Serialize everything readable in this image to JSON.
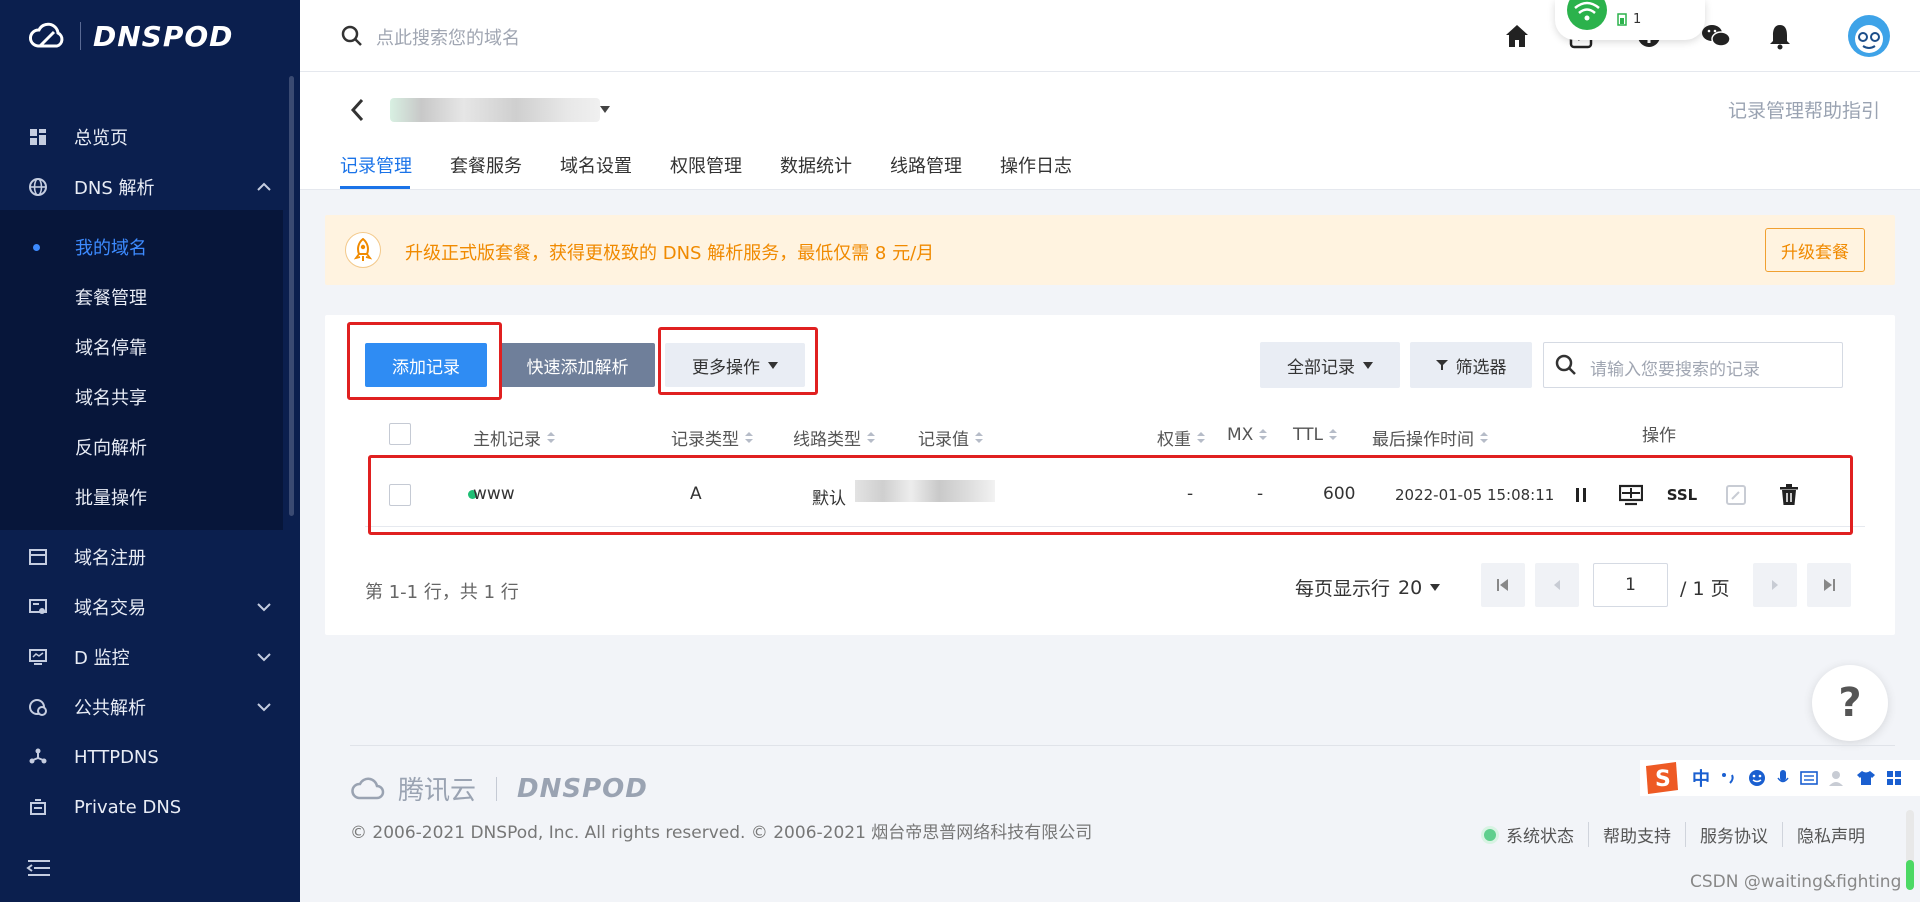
{
  "sidebar": {
    "brand": "DNSPOD",
    "items": [
      {
        "label": "总览页",
        "icon": "dashboard-icon"
      },
      {
        "label": "DNS 解析",
        "icon": "globe-icon"
      },
      {
        "label": "域名注册",
        "icon": "register-icon"
      },
      {
        "label": "域名交易",
        "icon": "trade-icon"
      },
      {
        "label": "D 监控",
        "icon": "monitor-icon"
      },
      {
        "label": "公共解析",
        "icon": "public-dns-icon"
      },
      {
        "label": "HTTPDNS",
        "icon": "httpdns-icon"
      },
      {
        "label": "Private DNS",
        "icon": "private-dns-icon"
      }
    ],
    "subitems": [
      {
        "label": "我的域名"
      },
      {
        "label": "套餐管理"
      },
      {
        "label": "域名停靠"
      },
      {
        "label": "域名共享"
      },
      {
        "label": "反向解析"
      },
      {
        "label": "批量操作"
      }
    ]
  },
  "header": {
    "search_placeholder": "点此搜索您的域名",
    "wifi_badge": "1"
  },
  "subheader": {
    "help_link": "记录管理帮助指引",
    "tabs": [
      {
        "label": "记录管理"
      },
      {
        "label": "套餐服务"
      },
      {
        "label": "域名设置"
      },
      {
        "label": "权限管理"
      },
      {
        "label": "数据统计"
      },
      {
        "label": "线路管理"
      },
      {
        "label": "操作日志"
      }
    ]
  },
  "banner": {
    "text": "升级正式版套餐，获得更极致的 DNS 解析服务，最低仅需 8 元/月",
    "button": "升级套餐",
    "accent": "#f08a00"
  },
  "toolbar": {
    "add_record": "添加记录",
    "quick_add": "快速添加解析",
    "more_ops": "更多操作",
    "all_records": "全部记录",
    "filter": "筛选器",
    "search_placeholder": "请输入您要搜索的记录"
  },
  "table": {
    "headers": {
      "host": "主机记录",
      "type": "记录类型",
      "line": "线路类型",
      "value": "记录值",
      "weight": "权重",
      "mx": "MX",
      "ttl": "TTL",
      "time": "最后操作时间",
      "ops": "操作"
    },
    "rows": [
      {
        "host": "www",
        "type": "A",
        "line": "默认",
        "weight": "-",
        "mx": "-",
        "ttl": "600",
        "time": "2022-01-05 15:08:11",
        "ssl": "SSL"
      }
    ]
  },
  "pagination": {
    "info": "第 1-1 行，共 1 行",
    "per_page_label": "每页显示行",
    "per_page_value": "20",
    "current_page": "1",
    "total_pages": "/ 1 页"
  },
  "help_bubble": "?",
  "footer": {
    "brand_cn": "腾讯云",
    "brand_en": "DNSPOD",
    "copyright": "© 2006-2021 DNSPod, Inc. All rights reserved. © 2006-2021 烟台帝思普网络科技有限公司",
    "links": [
      "系统状态",
      "帮助支持",
      "服务协议",
      "隐私声明"
    ]
  },
  "ime": {
    "label": "中"
  },
  "watermark": "CSDN @waiting&fighting"
}
